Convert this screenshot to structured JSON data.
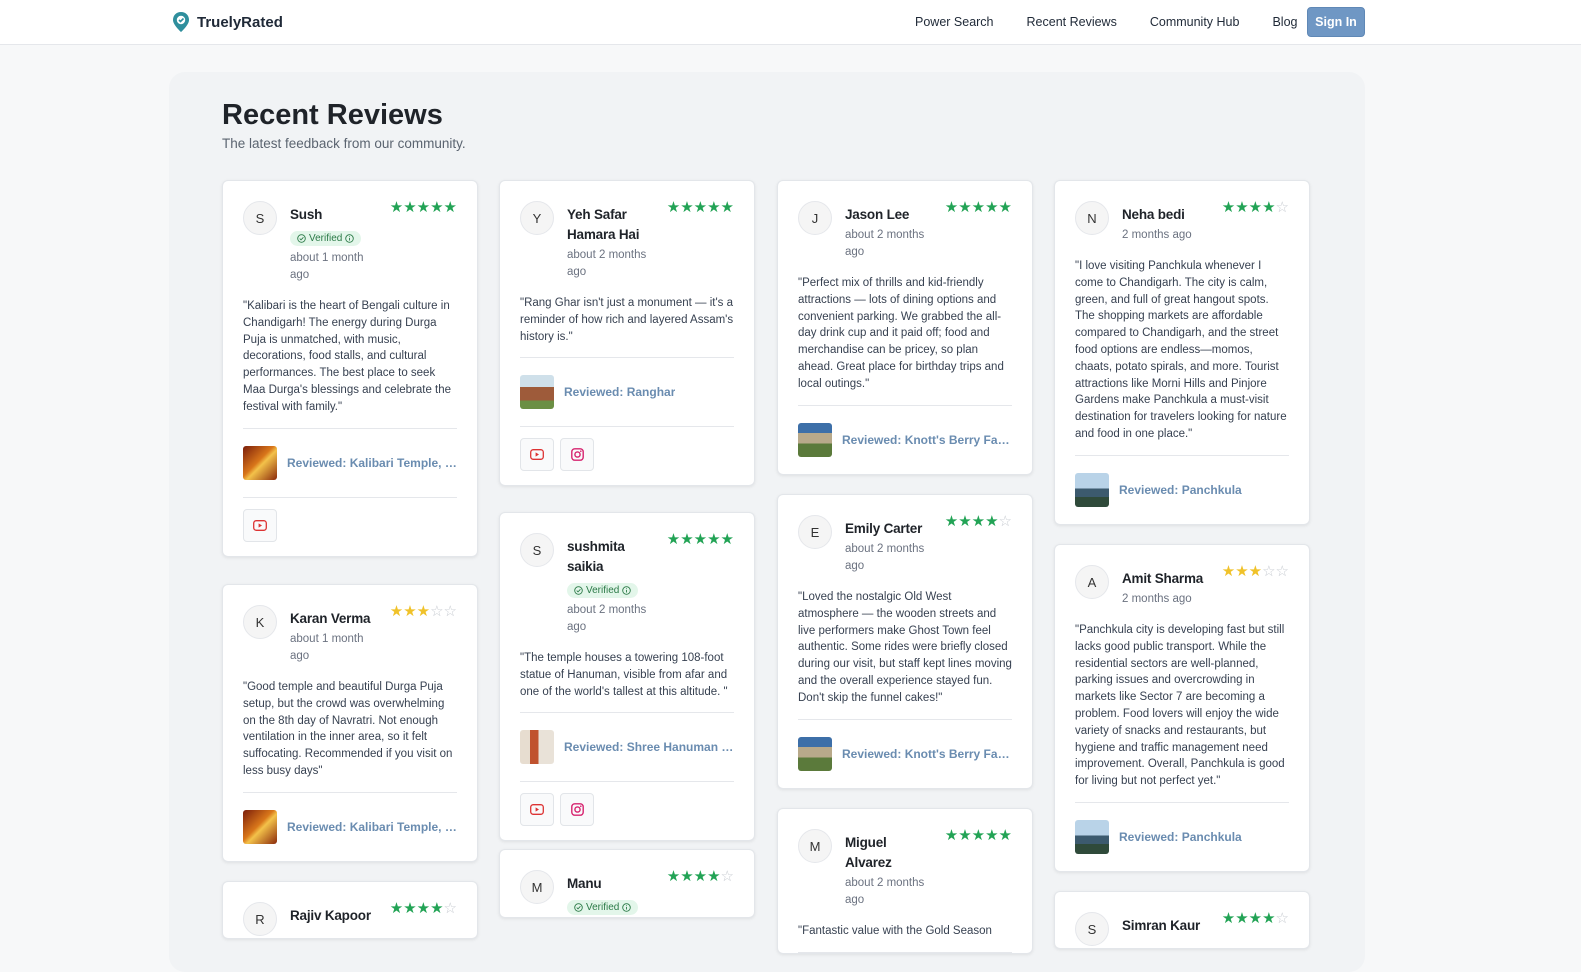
{
  "header": {
    "brand": "TruelyRated",
    "nav": [
      "Power Search",
      "Recent Reviews",
      "Community Hub",
      "Blog"
    ],
    "signin": "Sign In"
  },
  "page": {
    "title": "Recent Reviews",
    "subtitle": "The latest feedback from our community."
  },
  "verified_label": "Verified",
  "colors": {
    "star_high": "#22a355",
    "star_mid": "#f0c22a",
    "signin": "#6f97c4",
    "link": "#6a8cb0"
  },
  "reviews": [
    {
      "initial": "S",
      "name": "Sush",
      "verified": true,
      "time": "about 1 month ago",
      "rating": 5,
      "quote": "\"Kalibari is the heart of Bengali culture in Chandigarh! The energy during Durga Puja is unmatched, with music, decorations, food stalls, and cultural performances. The best place to seek Maa Durga's blessings and celebrate the festival with family.\"",
      "place": "Reviewed: Kalibari Temple, Ch...",
      "thumb": "kali",
      "social": [
        "youtube-icon"
      ]
    },
    {
      "initial": "K",
      "name": "Karan Verma",
      "verified": false,
      "time": "about 1 month ago",
      "rating": 3,
      "quote": "\"Good temple and beautiful Durga Puja setup, but the crowd was overwhelming on the 8th day of Navratri. Not enough ventilation in the inner area, so it felt suffocating. Recommended if you visit on less busy days\"",
      "place": "Reviewed: Kalibari Temple, Ch...",
      "thumb": "kali",
      "social": []
    },
    {
      "initial": "R",
      "name": "Rajiv Kapoor",
      "verified": false,
      "time": "",
      "rating": 4,
      "quote": "",
      "place": "",
      "thumb": "",
      "social": []
    },
    {
      "initial": "Y",
      "name": "Yeh Safar Hamara Hai",
      "verified": false,
      "time": "about 2 months ago",
      "rating": 5,
      "quote": "\"Rang Ghar isn't just a monument — it's a reminder of how rich and layered Assam's history is.\"",
      "place": "Reviewed: Ranghar",
      "thumb": "rang",
      "social": [
        "youtube-icon",
        "instagram-icon"
      ]
    },
    {
      "initial": "S",
      "name": "sushmita saikia",
      "verified": true,
      "time": "about 2 months ago",
      "rating": 5,
      "quote": "\"The temple houses a towering 108-foot statue of Hanuman, visible from afar and one of the world's tallest at this altitude. \"",
      "place": "Reviewed: Shree Hanuman Tem...",
      "thumb": "hanu",
      "social": [
        "youtube-icon",
        "instagram-icon"
      ]
    },
    {
      "initial": "M",
      "name": "Manu",
      "verified": true,
      "time": "",
      "rating": 4,
      "quote": "",
      "place": "",
      "thumb": "",
      "social": []
    },
    {
      "initial": "J",
      "name": "Jason Lee",
      "verified": false,
      "time": "about 2 months ago",
      "rating": 5,
      "quote": "\"Perfect mix of thrills and kid-friendly attractions — lots of dining options and convenient parking. We grabbed the all-day drink cup and it paid off; food and merchandise can be pricey, so plan ahead. Great place for birthday trips and local outings.\"",
      "place": "Reviewed: Knott's Berry Farm",
      "thumb": "knott",
      "social": []
    },
    {
      "initial": "E",
      "name": "Emily Carter",
      "verified": false,
      "time": "about 2 months ago",
      "rating": 4,
      "quote": "\"Loved the nostalgic Old West atmosphere — the wooden streets and live performers make Ghost Town feel authentic. Some rides were briefly closed during our visit, but staff kept lines moving and the overall experience stayed fun. Don't skip the funnel cakes!\"",
      "place": "Reviewed: Knott's Berry Farm",
      "thumb": "knott",
      "social": []
    },
    {
      "initial": "M",
      "name": "Miguel Alvarez",
      "verified": false,
      "time": "about 2 months ago",
      "rating": 5,
      "quote": "\"Fantastic value with the Gold Season",
      "place": "",
      "thumb": "",
      "social": []
    },
    {
      "initial": "N",
      "name": "Neha bedi",
      "verified": false,
      "time": "2 months ago",
      "rating": 4,
      "quote": "\"I love visiting Panchkula whenever I come to Chandigarh. The city is calm, green, and full of great hangout spots. The shopping markets are affordable compared to Chandigarh, and the street food options are endless—momos, chaats, potato spirals, and more. Tourist attractions like Morni Hills and Pinjore Gardens make Panchkula a must-visit destination for travelers looking for nature and food in one place.\"",
      "place": "Reviewed: Panchkula",
      "thumb": "panch",
      "social": []
    },
    {
      "initial": "A",
      "name": "Amit Sharma",
      "verified": false,
      "time": "2 months ago",
      "rating": 3,
      "quote": "\"Panchkula city is developing fast but still lacks good public transport. While the residential sectors are well-planned, parking issues and overcrowding in markets like Sector 7 are becoming a problem. Food lovers will enjoy the wide variety of snacks and restaurants, but hygiene and traffic management need improvement. Overall, Panchkula is good for living but not perfect yet.\"",
      "place": "Reviewed: Panchkula",
      "thumb": "panch",
      "social": []
    },
    {
      "initial": "S",
      "name": "Simran Kaur",
      "verified": false,
      "time": "",
      "rating": 4,
      "quote": "",
      "place": "",
      "thumb": "",
      "social": []
    }
  ]
}
